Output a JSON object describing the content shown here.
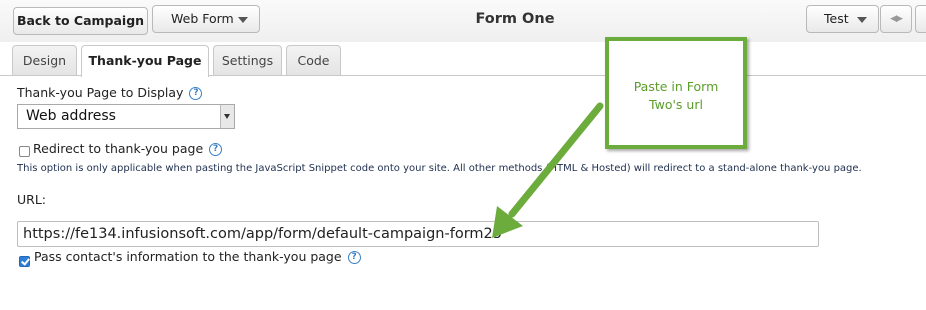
{
  "toolbar": {
    "back_label": "Back to Campaign",
    "form_type_label": "Web Form",
    "title": "Form One",
    "test_label": "Test"
  },
  "tabs": [
    {
      "label": "Design",
      "active": false
    },
    {
      "label": "Thank-you Page",
      "active": true
    },
    {
      "label": "Settings",
      "active": false
    },
    {
      "label": "Code",
      "active": false
    }
  ],
  "form": {
    "display_label": "Thank-you Page to Display",
    "display_value": "Web address",
    "redirect_label": "Redirect to thank-you page",
    "redirect_checked": false,
    "note": "This option is only applicable when pasting the JavaScript Snippet code onto your site. All other methods (HTML & Hosted) will redirect to a stand-alone thank-you page.",
    "url_label": "URL:",
    "url_value": "https://fe134.infusionsoft.com/app/form/default-campaign-form25",
    "pass_label": "Pass contact's information to the thank-you page",
    "pass_checked": true
  },
  "callout": {
    "line1": "Paste in Form",
    "line2": "Two's url",
    "color": "#6cac3c"
  }
}
